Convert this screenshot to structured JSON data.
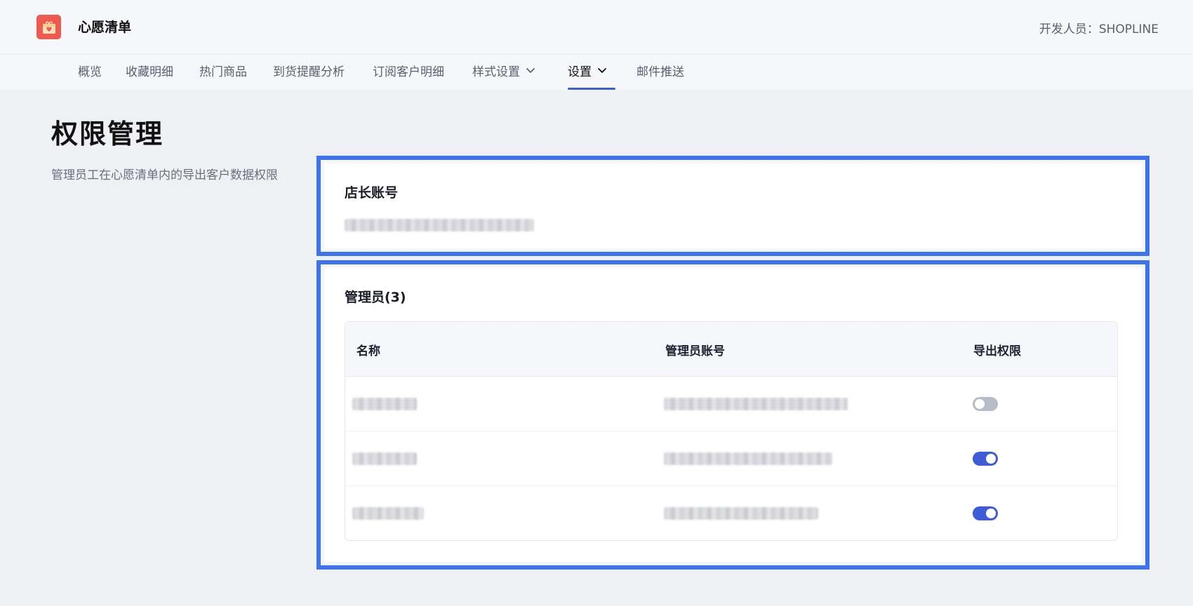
{
  "app": {
    "title": "心愿清单",
    "developer": "开发人员：SHOPLINE",
    "logo_icon": "gift-heart-icon",
    "logo_color": "#ee5a50"
  },
  "nav": {
    "items": [
      {
        "label": "概览"
      },
      {
        "label": "收藏明细"
      },
      {
        "label": "热门商品"
      },
      {
        "label": "到货提醒分析"
      },
      {
        "label": "订阅客户明细"
      },
      {
        "label": "样式设置",
        "has_dropdown": true
      },
      {
        "label": "设置",
        "has_dropdown": true,
        "active": true
      },
      {
        "label": "邮件推送"
      }
    ],
    "accent_color": "#3e5bd8"
  },
  "page": {
    "title": "权限管理",
    "description": "管理员工在心愿清单内的导出客户数据权限"
  },
  "owner_card": {
    "title": "店长账号"
  },
  "admins_card": {
    "title": "管理员(3)",
    "columns": [
      "名称",
      "管理员账号",
      "导出权限"
    ],
    "rows": [
      {
        "export_enabled": false
      },
      {
        "export_enabled": true
      },
      {
        "export_enabled": true
      }
    ]
  },
  "highlight_color": "#3d73ee"
}
